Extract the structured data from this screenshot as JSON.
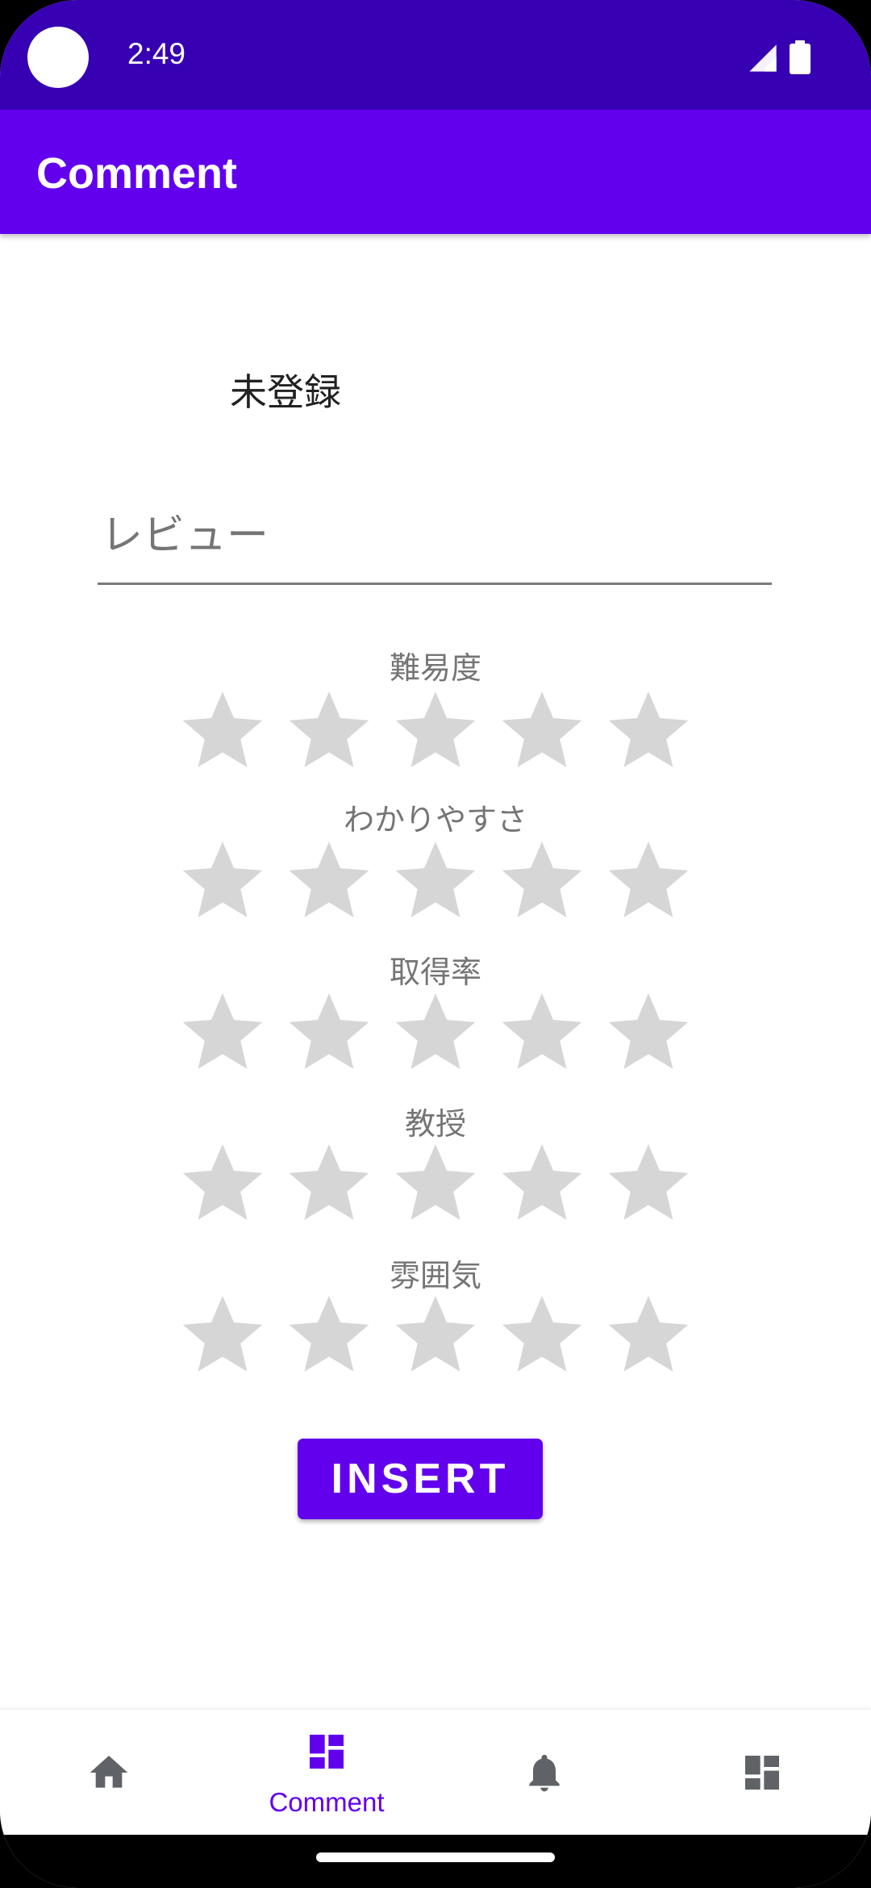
{
  "status_bar": {
    "time": "2:49",
    "icons": [
      "signal-icon",
      "battery-icon"
    ]
  },
  "app_bar": {
    "title": "Comment"
  },
  "colors": {
    "status_bar": "#3700b3",
    "primary": "#6200ee",
    "star_empty": "#d6d6d6",
    "label_gray": "#757575"
  },
  "content": {
    "user_name": "未登録",
    "review": {
      "value": "",
      "placeholder": "レビュー"
    },
    "ratings": [
      {
        "label": "難易度",
        "value": 0,
        "max": 5
      },
      {
        "label": "わかりやすさ",
        "value": 0,
        "max": 5
      },
      {
        "label": "取得率",
        "value": 0,
        "max": 5
      },
      {
        "label": "教授",
        "value": 0,
        "max": 5
      },
      {
        "label": "雰囲気",
        "value": 0,
        "max": 5
      }
    ],
    "insert_button_label": "INSERT"
  },
  "bottom_nav": {
    "items": [
      {
        "name": "home",
        "icon": "home-icon",
        "label": "",
        "selected": false
      },
      {
        "name": "comment",
        "icon": "dashboard-icon",
        "label": "Comment",
        "selected": true
      },
      {
        "name": "notifications",
        "icon": "bell-icon",
        "label": "",
        "selected": false
      },
      {
        "name": "dashboard",
        "icon": "dashboard-icon",
        "label": "",
        "selected": false
      }
    ]
  }
}
